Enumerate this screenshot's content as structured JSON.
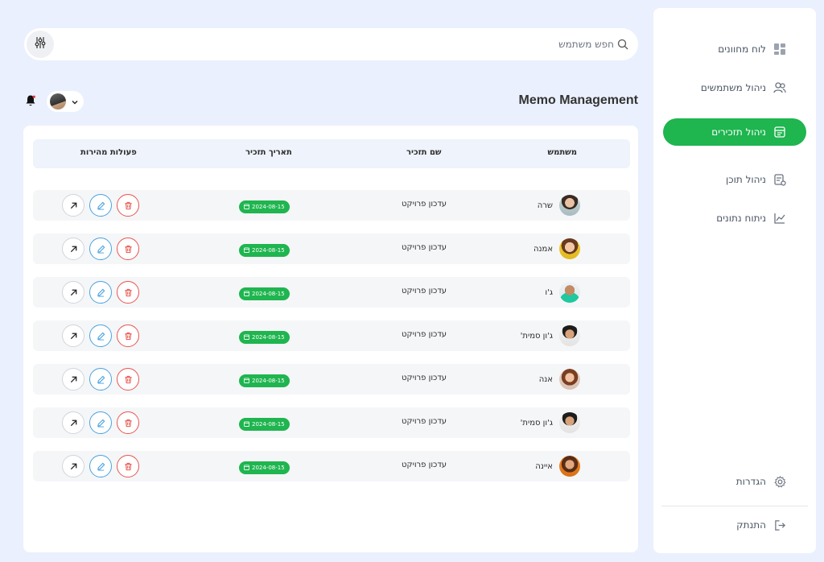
{
  "sidebar": {
    "items": [
      {
        "label": "לוח מחוונים",
        "icon": "dashboard-icon"
      },
      {
        "label": "ניהול משתמשים",
        "icon": "users-icon"
      },
      {
        "label": "ניהול תזכירים",
        "icon": "memo-icon",
        "active": true
      },
      {
        "label": "ניהול תוכן",
        "icon": "content-icon"
      },
      {
        "label": "ניתוח נתונים",
        "icon": "chart-icon"
      }
    ],
    "settings_label": "הגדרות",
    "logout_label": "התנתק"
  },
  "search": {
    "placeholder": "חפש משתמש"
  },
  "header": {
    "title": "Memo Management"
  },
  "table": {
    "columns": {
      "user": "משתמש",
      "memo_name": "שם תזכיר",
      "memo_date": "תאריך תזכיר",
      "quick_actions": "פעולות מהירות"
    },
    "rows": [
      {
        "user": "שרה",
        "memo": "עדכון פרויקט",
        "date": "2024-08-15"
      },
      {
        "user": "אמנה",
        "memo": "עדכון פרויקט",
        "date": "2024-08-15"
      },
      {
        "user": "ג'ו",
        "memo": "עדכון פרויקט",
        "date": "2024-08-15"
      },
      {
        "user": "ג'ון סמית'",
        "memo": "עדכון פרויקט",
        "date": "2024-08-15"
      },
      {
        "user": "אנה",
        "memo": "עדכון פרויקט",
        "date": "2024-08-15"
      },
      {
        "user": "ג'ון סמית'",
        "memo": "עדכון פרויקט",
        "date": "2024-08-15"
      },
      {
        "user": "איינה",
        "memo": "עדכון פרויקט",
        "date": "2024-08-15"
      }
    ]
  },
  "colors": {
    "accent": "#1fb54f",
    "background": "#eaf0fd",
    "edit": "#4aa3df",
    "delete": "#e8554e"
  }
}
